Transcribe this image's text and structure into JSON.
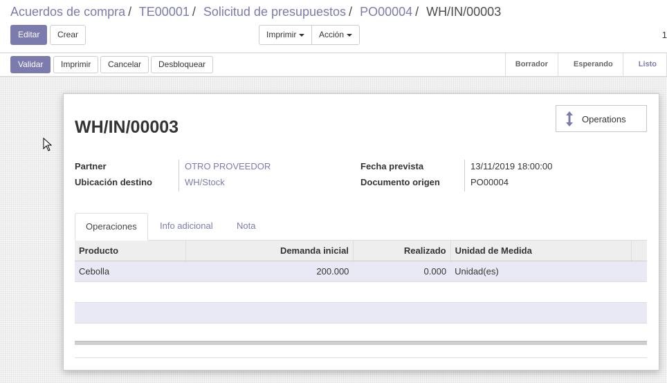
{
  "breadcrumb": {
    "items": [
      "Acuerdos de compra",
      "TE00001",
      "Solicitud de presupuestos",
      "PO00004"
    ],
    "current": "WH/IN/00003"
  },
  "toolbar": {
    "edit": "Editar",
    "create": "Crear",
    "print": "Imprimir",
    "action": "Acción",
    "pager": "1"
  },
  "statusbar": {
    "validate": "Validar",
    "print": "Imprimir",
    "cancel": "Cancelar",
    "unlock": "Desbloquear",
    "stages": [
      "Borrador",
      "Esperando",
      "Listo"
    ],
    "active_stage": "Listo"
  },
  "form": {
    "title": "WH/IN/00003",
    "operations_button": "Operations",
    "partner_label": "Partner",
    "partner_value": "OTRO PROVEEDOR",
    "location_label": "Ubicación destino",
    "location_value": "WH/Stock",
    "date_label": "Fecha prevista",
    "date_value": "13/11/2019 18:00:00",
    "origin_label": "Documento origen",
    "origin_value": "PO00004"
  },
  "tabs": [
    "Operaciones",
    "Info adicional",
    "Nota"
  ],
  "table": {
    "headers": [
      "Producto",
      "Demanda inicial",
      "Realizado",
      "Unidad de Medida"
    ],
    "rows": [
      [
        "Cebolla",
        "200.000",
        "0.000",
        "Unidad(es)"
      ]
    ]
  },
  "colors": {
    "accent": "#7c7bad"
  }
}
